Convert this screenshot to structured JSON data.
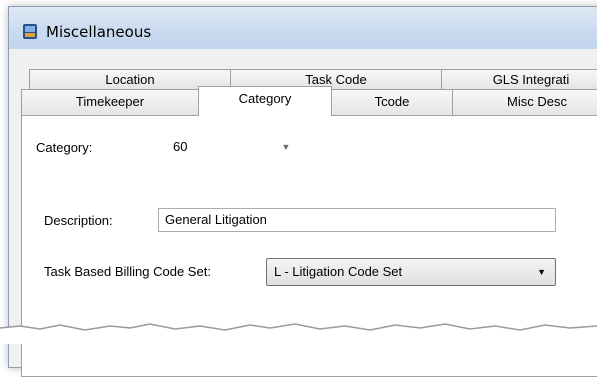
{
  "window": {
    "title": "Miscellaneous",
    "icon": "app-window-icon"
  },
  "tabs_row1": [
    {
      "label": "Location"
    },
    {
      "label": "Task Code"
    },
    {
      "label": "GLS Integrati"
    }
  ],
  "tabs_row2": [
    {
      "label": "Timekeeper",
      "active": false
    },
    {
      "label": "Category",
      "active": true
    },
    {
      "label": "Tcode",
      "active": false
    },
    {
      "label": "Misc Desc",
      "active": false
    }
  ],
  "form": {
    "category_label": "Category:",
    "category_value": "60",
    "description_label": "Description:",
    "description_value": "General Litigation",
    "task_billing_label": "Task Based Billing Code Set:",
    "task_billing_value": "L - Litigation Code Set"
  },
  "colors": {
    "titlebar": "#c9daf0",
    "panel": "#ffffff",
    "border": "#a0a0a0"
  }
}
